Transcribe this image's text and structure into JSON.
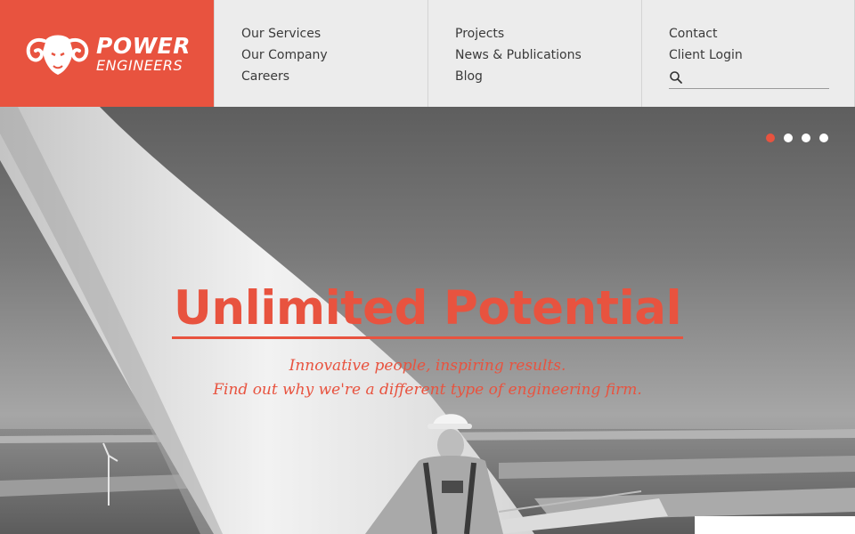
{
  "brand": {
    "line1": "POWER",
    "line2": "ENGINEERS",
    "color": "#e8533f",
    "icon": "ram-head-icon"
  },
  "nav": {
    "col1": [
      "Our Services",
      "Our Company",
      "Careers"
    ],
    "col2": [
      "Projects",
      "News & Publications",
      "Blog"
    ],
    "col3": [
      "Contact",
      "Client Login"
    ],
    "search": {
      "icon": "search-icon",
      "value": "",
      "placeholder": ""
    }
  },
  "hero": {
    "title": "Unlimited Potential",
    "subtitle_line1": "Innovative people, inspiring results.",
    "subtitle_line2": "Find out why we're a different type of engineering firm.",
    "slides": {
      "count": 4,
      "active_index": 0
    }
  }
}
